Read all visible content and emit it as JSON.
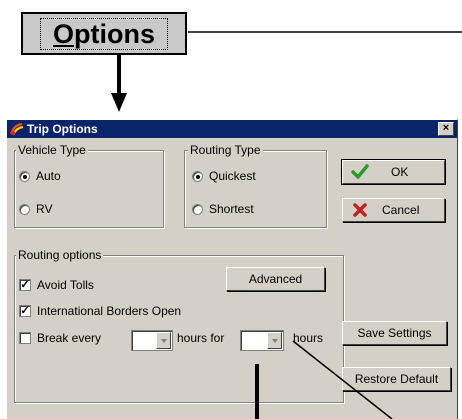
{
  "callout": {
    "options_button": {
      "prefix": "O",
      "rest": "ptions"
    }
  },
  "dialog": {
    "title": "Trip Options",
    "close_glyph": "×",
    "vehicle_type": {
      "legend": "Vehicle Type",
      "options": [
        {
          "label": "Auto",
          "selected": true
        },
        {
          "label": "RV",
          "selected": false
        }
      ]
    },
    "routing_type": {
      "legend": "Routing Type",
      "options": [
        {
          "label": "Quickest",
          "selected": true
        },
        {
          "label": "Shortest",
          "selected": false
        }
      ]
    },
    "routing_options": {
      "legend": "Routing options",
      "avoid_tolls": {
        "label": "Avoid Tolls",
        "checked": true
      },
      "intl_borders": {
        "label": "International Borders Open",
        "checked": true
      },
      "break_every": {
        "label": "Break every",
        "checked": false,
        "hours_value": "",
        "mid_label": "hours for",
        "duration_value": "",
        "end_label": "hours"
      },
      "advanced_label": "Advanced"
    },
    "buttons": {
      "ok": "OK",
      "cancel": "Cancel",
      "save_settings": "Save Settings",
      "restore_default": "Restore Default"
    },
    "colors": {
      "titlebar": "#0a246a",
      "ok_check": "#2a9a2a",
      "cancel_x": "#c81e1e"
    }
  }
}
